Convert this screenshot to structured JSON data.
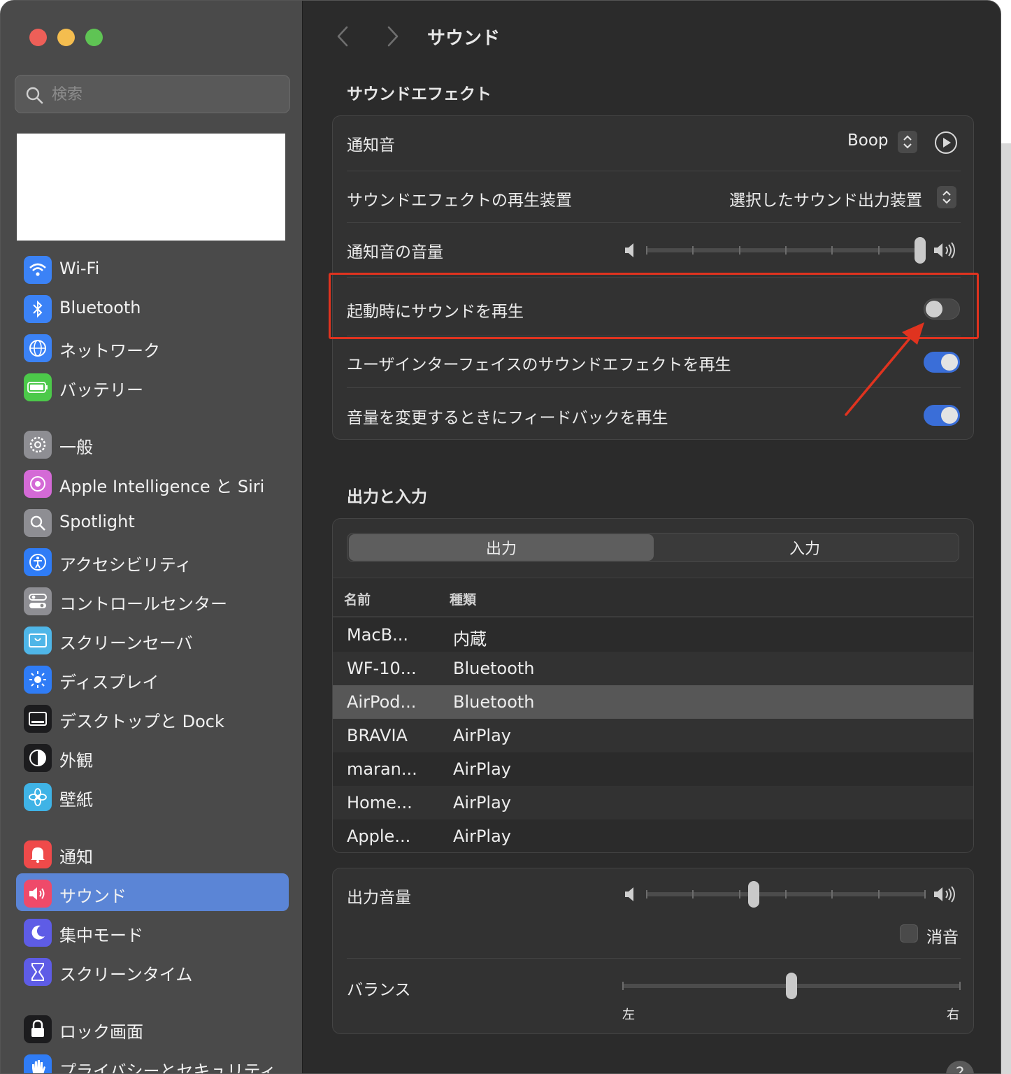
{
  "window": {
    "title": "サウンド"
  },
  "sidebar": {
    "search_placeholder": "検索",
    "groups": [
      [
        {
          "label": "Wi-Fi",
          "icon": "wifi-icon",
          "color": "#3b82f6"
        },
        {
          "label": "Bluetooth",
          "icon": "bluetooth-icon",
          "color": "#3b82f6"
        },
        {
          "label": "ネットワーク",
          "icon": "globe-icon",
          "color": "#3b82f6"
        },
        {
          "label": "バッテリー",
          "icon": "battery-icon",
          "color": "#4cc94a"
        }
      ],
      [
        {
          "label": "一般",
          "icon": "gear-icon",
          "color": "#8e8e93"
        },
        {
          "label": "Apple Intelligence と Siri",
          "icon": "siri-icon",
          "color": "#d46ad6"
        },
        {
          "label": "Spotlight",
          "icon": "magnifier-icon",
          "color": "#8e8e93"
        },
        {
          "label": "アクセシビリティ",
          "icon": "accessibility-icon",
          "color": "#2f7cf6"
        },
        {
          "label": "コントロールセンター",
          "icon": "control-center-icon",
          "color": "#8e8e93"
        },
        {
          "label": "スクリーンセーバ",
          "icon": "screensaver-icon",
          "color": "#4fb6e8"
        },
        {
          "label": "ディスプレイ",
          "icon": "sun-icon",
          "color": "#2f7cf6"
        },
        {
          "label": "デスクトップと Dock",
          "icon": "dock-icon",
          "color": "#1c1c1e"
        },
        {
          "label": "外観",
          "icon": "appearance-icon",
          "color": "#1c1c1e"
        },
        {
          "label": "壁紙",
          "icon": "wallpaper-icon",
          "color": "#3fb3e6"
        }
      ],
      [
        {
          "label": "通知",
          "icon": "bell-icon",
          "color": "#ef4a4a"
        },
        {
          "label": "サウンド",
          "icon": "speaker-icon",
          "color": "#ef4a6a",
          "selected": true
        },
        {
          "label": "集中モード",
          "icon": "moon-icon",
          "color": "#5e5ce6"
        },
        {
          "label": "スクリーンタイム",
          "icon": "hourglass-icon",
          "color": "#5e5ce6"
        }
      ],
      [
        {
          "label": "ロック画面",
          "icon": "lock-icon",
          "color": "#1c1c1e"
        },
        {
          "label": "プライバシーとセキュリティ",
          "icon": "hand-icon",
          "color": "#2f7cf6"
        }
      ]
    ]
  },
  "sound_effects": {
    "section_title": "サウンドエフェクト",
    "alert_sound_label": "通知音",
    "alert_sound_value": "Boop",
    "play_device_label": "サウンドエフェクトの再生装置",
    "play_device_value": "選択したサウンド出力装置",
    "alert_volume_label": "通知音の音量",
    "alert_volume_level": 1.0,
    "startup_sound_label": "起動時にサウンドを再生",
    "startup_sound_on": false,
    "ui_sound_label": "ユーザインターフェイスのサウンドエフェクトを再生",
    "ui_sound_on": true,
    "feedback_label": "音量を変更するときにフィードバックを再生",
    "feedback_on": true
  },
  "output_input": {
    "section_title": "出力と入力",
    "tabs": [
      "出力",
      "入力"
    ],
    "active_tab": 0,
    "columns": [
      "名前",
      "種類"
    ],
    "devices": [
      {
        "name": "MacB...",
        "type": "内蔵"
      },
      {
        "name": "WF-10...",
        "type": "Bluetooth"
      },
      {
        "name": "AirPod...",
        "type": "Bluetooth",
        "selected": true
      },
      {
        "name": "BRAVIA",
        "type": "AirPlay"
      },
      {
        "name": "maran...",
        "type": "AirPlay"
      },
      {
        "name": "Home...",
        "type": "AirPlay"
      },
      {
        "name": "Apple...",
        "type": "AirPlay"
      }
    ]
  },
  "output_volume": {
    "label": "出力音量",
    "level": 0.38,
    "mute_label": "消音",
    "muted": false,
    "balance_label": "バランス",
    "balance_level": 0.5,
    "left_label": "左",
    "right_label": "右"
  },
  "help_label": "?",
  "colors": {
    "accent": "#3a6ed8",
    "annotation": "#e0331f",
    "selection": "#5b85d6"
  }
}
